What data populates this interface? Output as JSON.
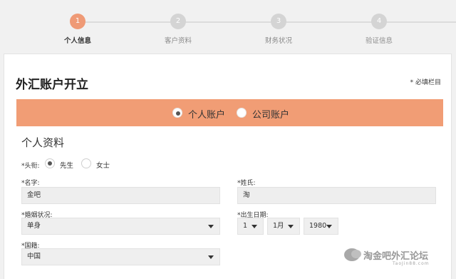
{
  "steps": [
    {
      "number": "1",
      "label": "个人信息"
    },
    {
      "number": "2",
      "label": "客户资料"
    },
    {
      "number": "3",
      "label": "财务状况"
    },
    {
      "number": "4",
      "label": "验证信息"
    }
  ],
  "form": {
    "title": "外汇账户开立",
    "required_note": "* 必填栏目"
  },
  "account_type": {
    "selected": "个人账户",
    "options": [
      "个人账户",
      "公司账户"
    ]
  },
  "personal": {
    "section_title": "个人资料",
    "salutation": {
      "label": "*头衔:",
      "options": [
        "先生",
        "女士"
      ],
      "selected": "先生"
    },
    "first_name": {
      "label": "*名字:",
      "value": "金吧"
    },
    "last_name": {
      "label": "*姓氏:",
      "value": "淘"
    },
    "marital_status": {
      "label": "*婚姻状况:",
      "value": "单身"
    },
    "birth_date": {
      "label": "*出生日期:",
      "day": "1",
      "month": "1月",
      "year": "1980"
    },
    "nationality": {
      "label": "*国籍:",
      "value": "中国"
    }
  },
  "watermark": {
    "text": "淘金吧外汇论坛",
    "sub": "TaoJin88.com"
  },
  "colors": {
    "accent": "#f19d75",
    "step_active": "#ef9a76",
    "step_inactive": "#d4d4d4",
    "background": "#f1f1f1"
  }
}
